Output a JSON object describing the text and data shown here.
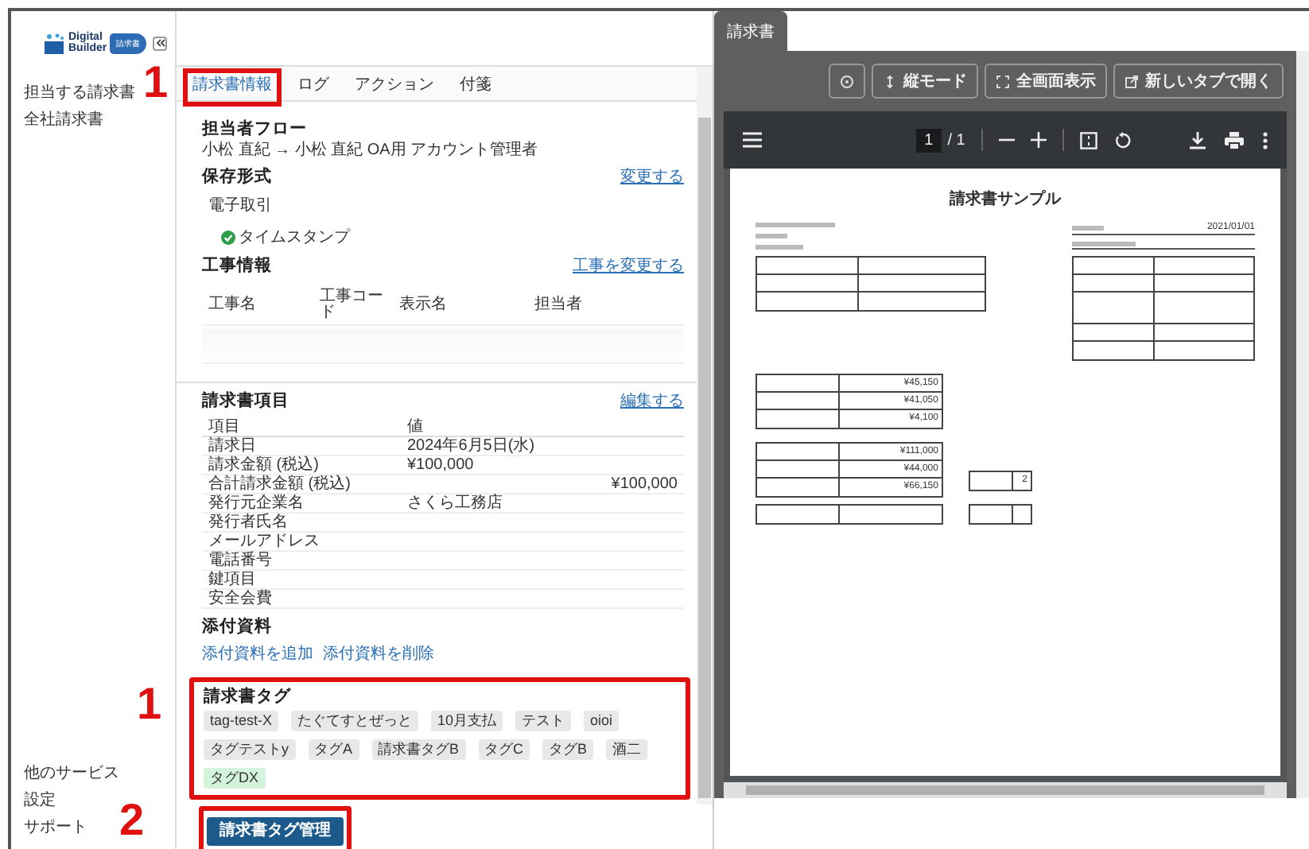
{
  "sidebar": {
    "logo": {
      "word_1": "Digital",
      "word_2": "Builder",
      "badge": "請求書"
    },
    "nav_items": [
      {
        "label": "担当する請求書"
      },
      {
        "label": "全社請求書"
      }
    ],
    "footer_items": [
      {
        "label": "他のサービス"
      },
      {
        "label": "設定"
      },
      {
        "label": "サポート"
      }
    ]
  },
  "tabs": [
    {
      "label": "請求書情報",
      "selected": true
    },
    {
      "label": "ログ",
      "selected": false
    },
    {
      "label": "アクション",
      "selected": false
    },
    {
      "label": "付箋",
      "selected": false
    }
  ],
  "flow": {
    "title": "担当者フロー",
    "text": "小松 直紀 → 小松 直紀 OA用 アカウント管理者"
  },
  "storage": {
    "title": "保存形式",
    "link": "変更する",
    "value": "電子取引",
    "timestamp": {
      "label": "タイムスタンプ",
      "checked": true
    }
  },
  "construction": {
    "title": "工事情報",
    "link": "工事を変更する",
    "columns": [
      "工事名",
      "工事コード",
      "表示名",
      "担当者"
    ]
  },
  "invoice_items": {
    "title": "請求書項目",
    "link": "編集する",
    "columns": [
      "項目",
      "値"
    ],
    "rows": [
      {
        "label": "請求日",
        "value": "2024年6月5日(水)"
      },
      {
        "label": "請求金額 (税込)",
        "value": "¥100,000"
      },
      {
        "label": "合計請求金額 (税込)",
        "column_3": "¥100,000"
      },
      {
        "label": "発行元企業名",
        "value": "さくら工務店"
      },
      {
        "label": "発行者氏名"
      },
      {
        "label": "メールアドレス"
      },
      {
        "label": "電話番号"
      },
      {
        "label": "鍵項目"
      },
      {
        "label": "安全会費"
      }
    ]
  },
  "attachments": {
    "title": "添付資料",
    "links": [
      "添付資料を追加",
      "添付資料を削除"
    ]
  },
  "tags": {
    "title": "請求書タグ",
    "items": [
      {
        "label": "tag-test-X",
        "color": "#e8e8e8"
      },
      {
        "label": "たぐてすとぜっと",
        "color": "#e8e8e8"
      },
      {
        "label": "10月支払",
        "color": "#e8e8e8"
      },
      {
        "label": "テスト",
        "color": "#e8e8e8"
      },
      {
        "label": "oioi",
        "color": "#e8e8e8"
      },
      {
        "label": "タグテストy",
        "color": "#e8e8e8"
      },
      {
        "label": "タグA",
        "color": "#e8e8e8"
      },
      {
        "label": "請求書タグB",
        "color": "#e8e8e8"
      },
      {
        "label": "タグC",
        "color": "#e8e8e8"
      },
      {
        "label": "タグB",
        "color": "#e8e8e8"
      },
      {
        "label": "酒二",
        "color": "#e8e8e8"
      },
      {
        "label": "タグDX",
        "color": "#d3f3da"
      }
    ]
  },
  "tag_button": "請求書タグ管理",
  "callouts": {
    "tabs": "1",
    "tags": "1",
    "button": "2"
  },
  "viewer": {
    "tab": "請求書",
    "buttons": [
      {
        "kind": "info"
      },
      {
        "kind": "vertical",
        "label": "縦モード"
      },
      {
        "kind": "fullscreen",
        "label": "全画面表示"
      },
      {
        "kind": "external",
        "label": "新しいタブで開く"
      }
    ],
    "page_input": "1",
    "page_count": "/ 1",
    "document": {
      "title": "請求書サンプル",
      "date": "2021/01/01",
      "amounts": [
        "¥45,150",
        "¥41,050",
        "¥4,100"
      ],
      "contract_amounts": [
        "¥111,000",
        "¥44,000",
        "¥66,150"
      ],
      "count": "2"
    }
  }
}
